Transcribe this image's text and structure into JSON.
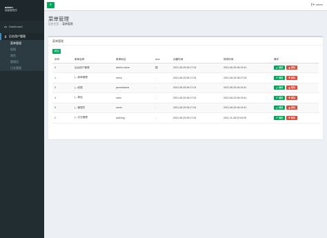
{
  "sidebar": {
    "user": "admin",
    "role": "超级管理员",
    "dashboard": "Dashboard",
    "group": "后台用户管理",
    "items": [
      "菜单管理",
      "权限",
      "角色",
      "管理员",
      "日志管理"
    ]
  },
  "header": {
    "menu_icon": "≡",
    "user": "admin"
  },
  "page": {
    "title": "菜单管理",
    "breadcrumb": [
      "后台主页",
      "菜单管理"
    ]
  },
  "box": {
    "title": "菜单管理",
    "add_label": "添加"
  },
  "table": {
    "columns": [
      "序号",
      "菜单名称",
      "菜单地址",
      "icon",
      "创建时间",
      "修改时间",
      "操作"
    ],
    "rows": [
      [
        "0",
        "后台用户管理",
        "admin-users",
        "图",
        "2021-06-25 06:17:24",
        "2021-06-25 06:19:41"
      ],
      [
        "1",
        "|---菜单管理",
        "menu",
        "-",
        "2021-06-25 06:17:24",
        "2021-06-25 06:27:04"
      ],
      [
        "3",
        "|---权限",
        "permissions",
        "-",
        "2021-06-25 06:17:24",
        "2021-06-25 06:19:41"
      ],
      [
        "4",
        "|---角色",
        "roles",
        "-",
        "2021-06-25 06:17:24",
        "2021-06-25 06:19:41"
      ],
      [
        "5",
        "|---管理员",
        "users",
        "-",
        "2021-06-25 06:17:24",
        "2021-06-25 06:19:41"
      ],
      [
        "2",
        "|---日志管理",
        "auth/log",
        "-",
        "2021-06-25 06:17:24",
        "2021-11-28 02:04:39"
      ]
    ],
    "edit_label": "编辑",
    "delete_label": "删除"
  }
}
